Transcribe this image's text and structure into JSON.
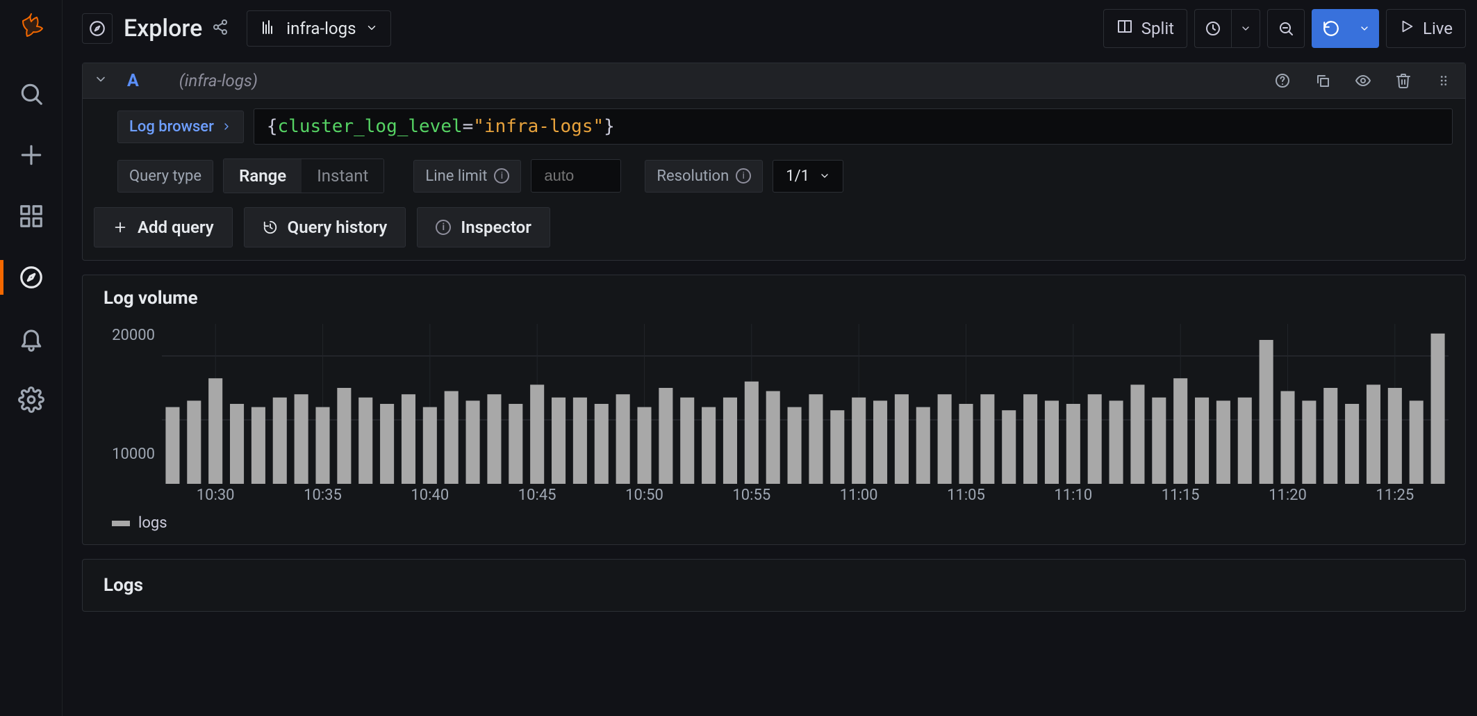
{
  "page": {
    "title": "Explore",
    "datasource": "infra-logs"
  },
  "topbar": {
    "split_label": "Split",
    "live_label": "Live"
  },
  "query": {
    "name": "A",
    "ds_label": "(infra-logs)",
    "log_browser_label": "Log browser",
    "expression": {
      "open": "{",
      "key": "cluster_log_level",
      "eq": "=",
      "value": "\"infra-logs\"",
      "close": "}"
    },
    "query_type_label": "Query type",
    "range_label": "Range",
    "instant_label": "Instant",
    "line_limit_label": "Line limit",
    "line_limit_placeholder": "auto",
    "resolution_label": "Resolution",
    "resolution_value": "1/1"
  },
  "actions": {
    "add_query": "Add query",
    "query_history": "Query history",
    "inspector": "Inspector"
  },
  "volume": {
    "title": "Log volume",
    "legend": "logs"
  },
  "logs": {
    "title": "Logs"
  },
  "chart_data": {
    "type": "bar",
    "title": "Log volume",
    "xlabel": "",
    "ylabel": "",
    "ylim": [
      0,
      25000
    ],
    "y_ticks": [
      "20000",
      "10000"
    ],
    "x_ticks": [
      "10:30",
      "10:35",
      "10:40",
      "10:45",
      "10:50",
      "10:55",
      "11:00",
      "11:05",
      "11:10",
      "11:15",
      "11:20",
      "11:25"
    ],
    "categories": [
      "10:28",
      "10:29",
      "10:30",
      "10:31",
      "10:32",
      "10:33",
      "10:34",
      "10:35",
      "10:36",
      "10:37",
      "10:38",
      "10:39",
      "10:40",
      "10:41",
      "10:42",
      "10:43",
      "10:44",
      "10:45",
      "10:46",
      "10:47",
      "10:48",
      "10:49",
      "10:50",
      "10:51",
      "10:52",
      "10:53",
      "10:54",
      "10:55",
      "10:56",
      "10:57",
      "10:58",
      "10:59",
      "11:00",
      "11:01",
      "11:02",
      "11:03",
      "11:04",
      "11:05",
      "11:06",
      "11:07",
      "11:08",
      "11:09",
      "11:10",
      "11:11",
      "11:12",
      "11:13",
      "11:14",
      "11:15",
      "11:16",
      "11:17",
      "11:18",
      "11:19",
      "11:20",
      "11:21",
      "11:22",
      "11:23",
      "11:24",
      "11:25",
      "11:26",
      "11:27"
    ],
    "values": [
      12000,
      13000,
      16500,
      12500,
      12000,
      13500,
      14000,
      12000,
      15000,
      13500,
      12500,
      14000,
      12000,
      14500,
      13000,
      14000,
      12500,
      15500,
      13500,
      13500,
      12500,
      14000,
      12000,
      15000,
      13500,
      12000,
      13500,
      16000,
      14500,
      12000,
      14000,
      11500,
      13500,
      13000,
      14000,
      12000,
      14000,
      12500,
      14000,
      11500,
      14000,
      13000,
      12500,
      14000,
      13000,
      15500,
      13500,
      16500,
      13500,
      13000,
      13500,
      22500,
      14500,
      13000,
      15000,
      12500,
      15500,
      15000,
      13000,
      23500
    ],
    "series": [
      {
        "name": "logs",
        "values": [
          12000,
          13000,
          16500,
          12500,
          12000,
          13500,
          14000,
          12000,
          15000,
          13500,
          12500,
          14000,
          12000,
          14500,
          13000,
          14000,
          12500,
          15500,
          13500,
          13500,
          12500,
          14000,
          12000,
          15000,
          13500,
          12000,
          13500,
          16000,
          14500,
          12000,
          14000,
          11500,
          13500,
          13000,
          14000,
          12000,
          14000,
          12500,
          14000,
          11500,
          14000,
          13000,
          12500,
          14000,
          13000,
          15500,
          13500,
          16500,
          13500,
          13000,
          13500,
          22500,
          14500,
          13000,
          15000,
          12500,
          15500,
          15000,
          13000,
          23500
        ]
      }
    ]
  }
}
